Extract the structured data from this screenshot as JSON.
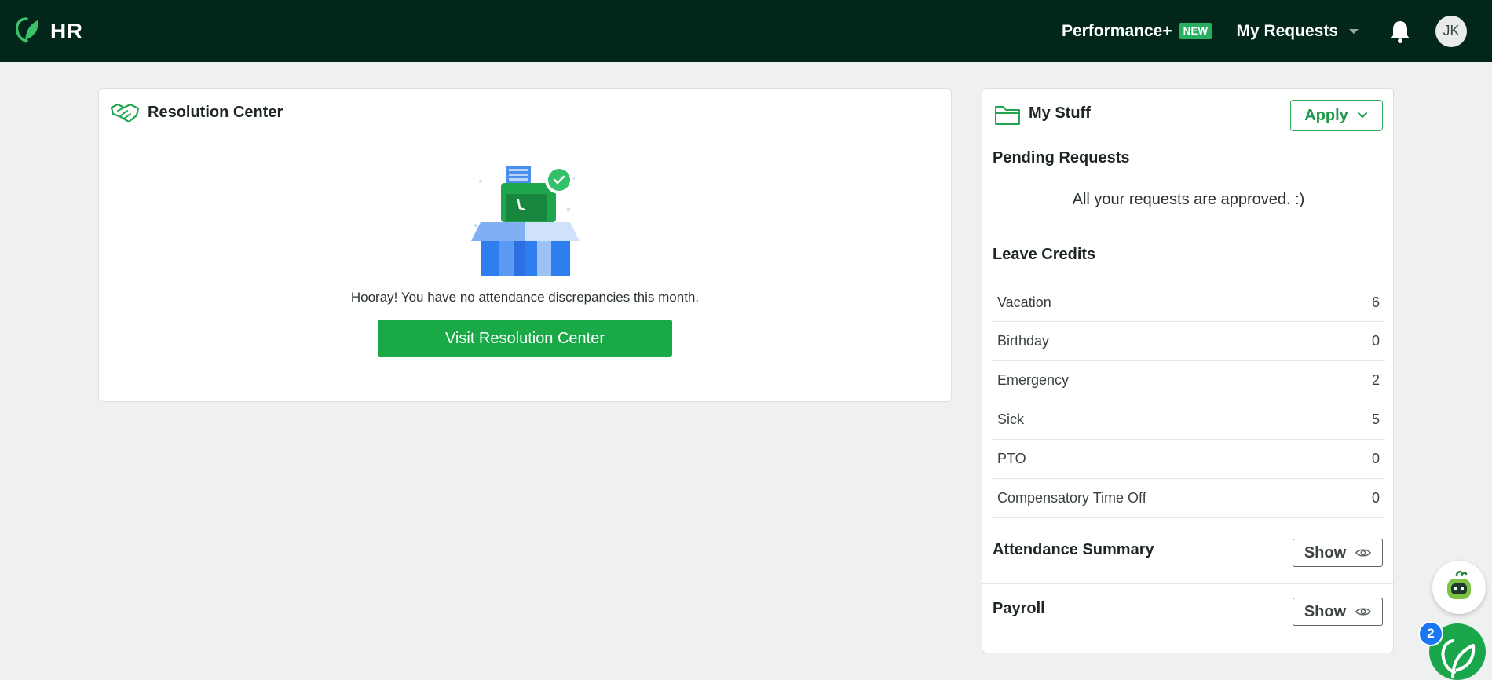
{
  "header": {
    "brand": "HR",
    "performance_label": "Performance+",
    "new_badge": "NEW",
    "my_requests_label": "My Requests",
    "avatar_initials": "JK"
  },
  "resolution_center": {
    "title": "Resolution Center",
    "message": "Hooray! You have no attendance discrepancies this month.",
    "button_label": "Visit Resolution Center"
  },
  "my_stuff": {
    "title": "My Stuff",
    "apply_label": "Apply",
    "pending_title": "Pending Requests",
    "pending_message": "All your requests are approved. :)",
    "leave_credits_title": "Leave Credits",
    "leave_credits": [
      {
        "type": "Vacation",
        "value": "6"
      },
      {
        "type": "Birthday",
        "value": "0"
      },
      {
        "type": "Emergency",
        "value": "2"
      },
      {
        "type": "Sick",
        "value": "5"
      },
      {
        "type": "PTO",
        "value": "0"
      },
      {
        "type": "Compensatory Time Off",
        "value": "0"
      }
    ],
    "attendance_title": "Attendance Summary",
    "payroll_title": "Payroll",
    "show_label": "Show"
  },
  "floating": {
    "notification_count": "2"
  },
  "colors": {
    "topbar": "#02261a",
    "accent_green": "#19aa47",
    "badge_blue": "#1877f2"
  }
}
